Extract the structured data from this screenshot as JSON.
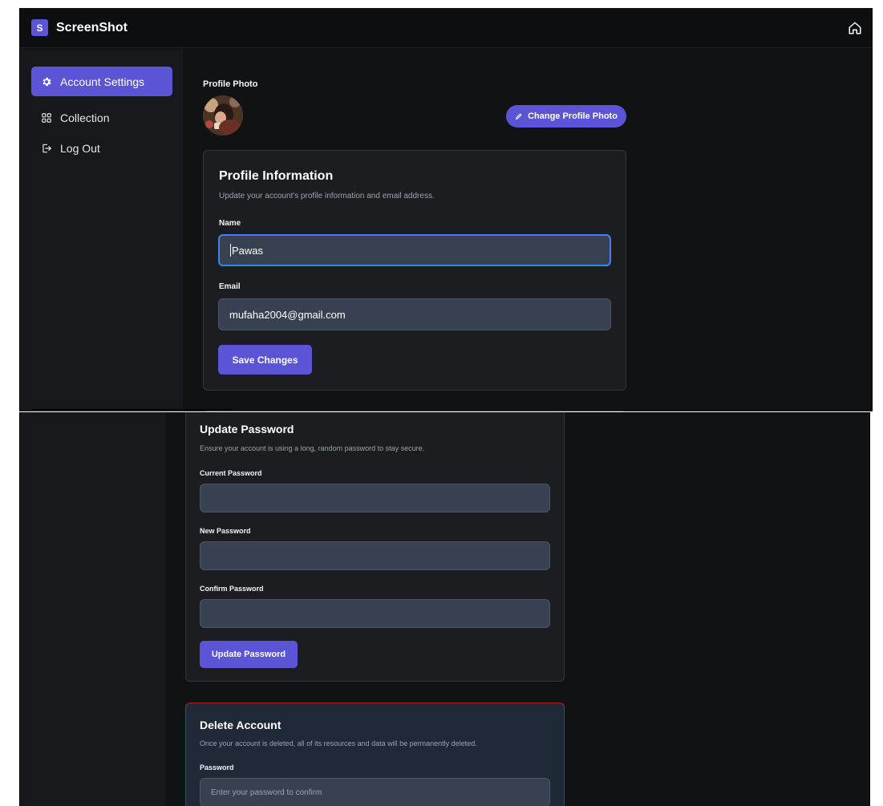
{
  "brand": {
    "badge": "S",
    "name": "ScreenShot"
  },
  "sidebar": {
    "items": [
      {
        "label": "Account Settings",
        "icon": "gear-icon",
        "active": true
      },
      {
        "label": "Collection",
        "icon": "grid-icon",
        "active": false
      },
      {
        "label": "Log Out",
        "icon": "logout-icon",
        "active": false
      }
    ]
  },
  "profile_photo": {
    "label": "Profile Photo",
    "change_button": "Change Profile Photo"
  },
  "profile_info": {
    "title": "Profile Information",
    "subtitle": "Update your account's profile information and email address.",
    "name_label": "Name",
    "name_value": "Pawas",
    "email_label": "Email",
    "email_value": "mufaha2004@gmail.com",
    "save_button": "Save Changes"
  },
  "update_password": {
    "title": "Update Password",
    "subtitle": "Ensure your account is using a long, random password to stay secure.",
    "current_label": "Current Password",
    "new_label": "New Password",
    "confirm_label": "Confirm Password",
    "button": "Update Password"
  },
  "delete_account": {
    "title": "Delete Account",
    "subtitle": "Once your account is deleted, all of its resources and data will be permanently deleted.",
    "password_label": "Password",
    "password_placeholder": "Enter your password to confirm"
  },
  "colors": {
    "accent": "#5b55d6",
    "background": "#111214",
    "card": "#1c1d20",
    "input": "#384152",
    "danger_border": "#b91c1c"
  }
}
